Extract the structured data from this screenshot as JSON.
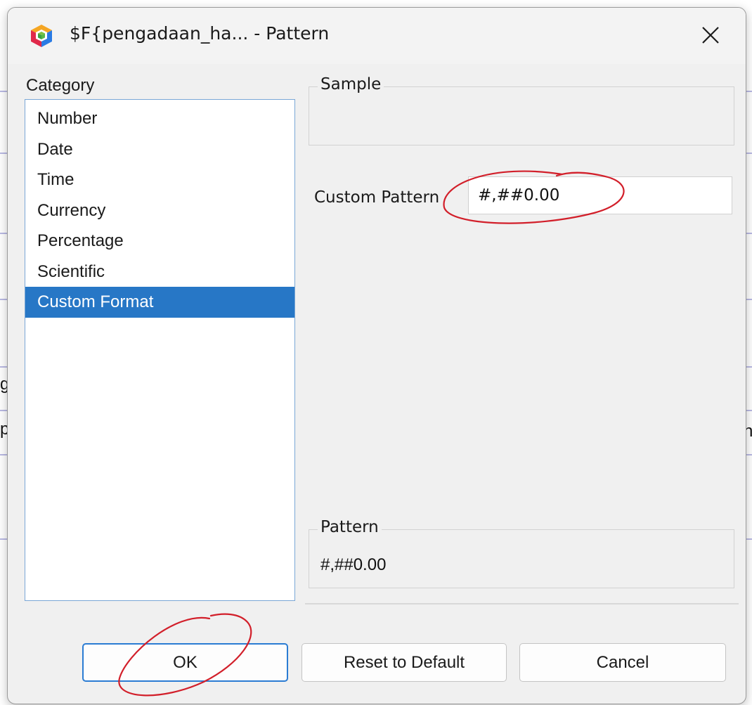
{
  "background": {
    "fragment_left_1": "g",
    "fragment_left_2": "p",
    "fragment_right_1": "n_"
  },
  "dialog": {
    "title": "$F{pengadaan_ha... - Pattern",
    "app_icon": "netbeans-cube-icon",
    "close_icon": "close-icon"
  },
  "category": {
    "label": "Category",
    "items": [
      "Number",
      "Date",
      "Time",
      "Currency",
      "Percentage",
      "Scientific",
      "Custom Format"
    ],
    "selected": "Custom Format"
  },
  "sample": {
    "legend": "Sample"
  },
  "custom_pattern": {
    "label": "Custom Pattern",
    "value": "#,##0.00"
  },
  "pattern": {
    "legend": "Pattern",
    "value": "#,##0.00"
  },
  "buttons": {
    "ok": "OK",
    "reset": "Reset to Default",
    "cancel": "Cancel"
  },
  "colors": {
    "selection": "#2777c6",
    "annotation": "#d21f2a",
    "ok_border": "#2b7cd3"
  }
}
